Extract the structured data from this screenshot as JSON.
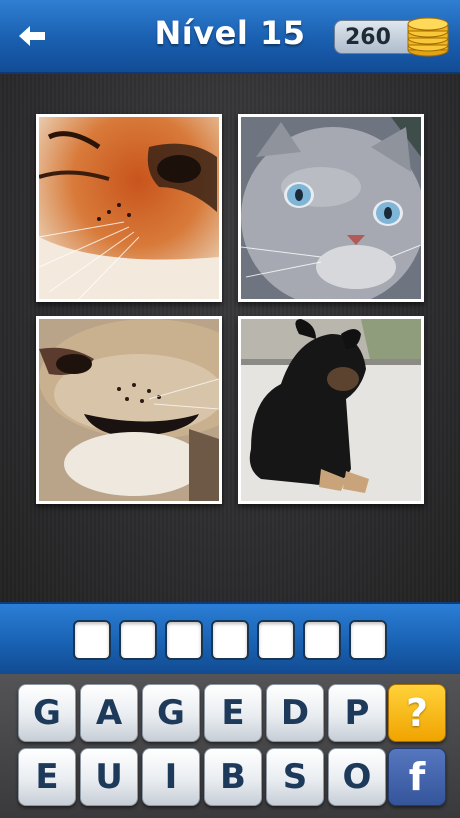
{
  "header": {
    "title": "Nível 15",
    "coins": "260",
    "back_icon": "back-arrow-icon",
    "coin_icon": "coin-stack-icon"
  },
  "photos": [
    {
      "name": "tiger-nose-photo"
    },
    {
      "name": "gray-cat-photo"
    },
    {
      "name": "lion-muzzle-photo"
    },
    {
      "name": "black-dog-photo"
    }
  ],
  "answer": {
    "slots": [
      "",
      "",
      "",
      "",
      "",
      "",
      ""
    ]
  },
  "keyboard": {
    "row1": [
      "G",
      "A",
      "G",
      "E",
      "D",
      "P"
    ],
    "row2": [
      "E",
      "U",
      "I",
      "B",
      "S",
      "O"
    ],
    "hint_label": "?",
    "facebook_label": "f"
  },
  "colors": {
    "header_blue": "#1a5fb0",
    "hint_orange": "#f0a400",
    "facebook_blue": "#3b5998"
  }
}
